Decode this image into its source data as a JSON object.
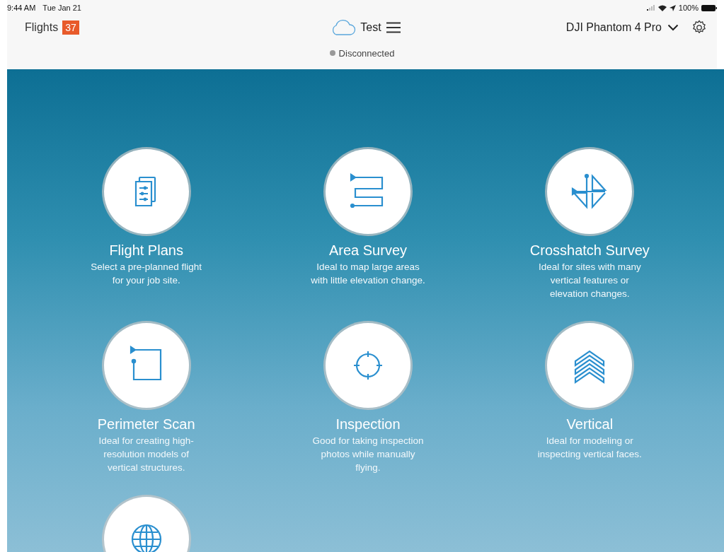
{
  "status_bar": {
    "time": "9:44 AM",
    "date": "Tue Jan 21",
    "battery_text": "100%"
  },
  "header": {
    "flights_label": "Flights",
    "flights_count": "37",
    "project": "Test",
    "drone": "DJI Phantom 4 Pro",
    "connection": "Disconnected"
  },
  "modes": [
    {
      "kind": "plans",
      "title": "Flight Plans",
      "description": [
        "Select a pre-planned flight",
        "for your job site."
      ]
    },
    {
      "kind": "area",
      "title": "Area Survey",
      "description": [
        "Ideal to map large areas",
        "with little elevation change."
      ]
    },
    {
      "kind": "crosshatch",
      "title": "Crosshatch Survey",
      "description": [
        "Ideal for sites with many",
        "vertical features or",
        "elevation changes."
      ]
    },
    {
      "kind": "perimeter",
      "title": "Perimeter Scan",
      "description": [
        "Ideal for creating high-",
        "resolution models of",
        "vertical structures."
      ]
    },
    {
      "kind": "inspection",
      "title": "Inspection",
      "description": [
        "Good for taking inspection",
        "photos while manually",
        "flying."
      ]
    },
    {
      "kind": "vertical",
      "title": "Vertical",
      "description": [
        "Ideal for modeling or",
        "inspecting vertical faces."
      ]
    },
    {
      "kind": "globe"
    }
  ]
}
